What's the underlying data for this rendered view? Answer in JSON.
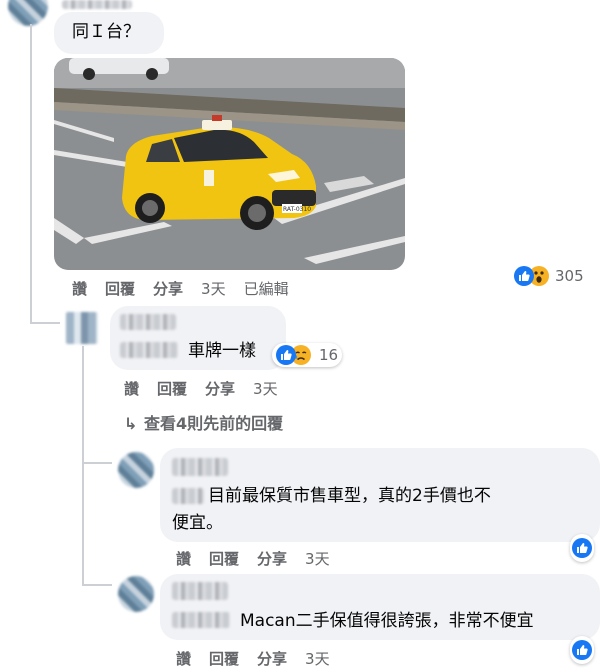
{
  "comment1": {
    "text": "同Ｉ台？",
    "actions": {
      "like": "讚",
      "reply": "回覆",
      "share": "分享",
      "time": "3天",
      "edited": "已編輯"
    },
    "reactions": {
      "count": "305",
      "icons": [
        "like-icon",
        "wow-icon"
      ]
    }
  },
  "comment2": {
    "text": "車牌一樣",
    "actions": {
      "like": "讚",
      "reply": "回覆",
      "share": "分享",
      "time": "3天"
    },
    "reactions": {
      "count": "16",
      "icons": [
        "like-icon",
        "sad-icon"
      ]
    }
  },
  "view_previous": {
    "label": "查看4則先前的回覆"
  },
  "comment3": {
    "text_line1": "目前最保質市售車型，真的2手價也不",
    "text_line2": "便宜。",
    "actions": {
      "like": "讚",
      "reply": "回覆",
      "share": "分享",
      "time": "3天"
    },
    "reactions": {
      "icons": [
        "like-icon"
      ]
    }
  },
  "comment4": {
    "text": "Macan二手保值得很誇張，非常不便宜",
    "actions": {
      "like": "讚",
      "reply": "回覆",
      "share": "分享",
      "time": "3天"
    },
    "reactions": {
      "icons": [
        "like-icon"
      ]
    }
  },
  "photo": {
    "plate_text": "RAT-0310"
  },
  "colors": {
    "like_blue": "#1877f2",
    "bubble": "#f0f2f5",
    "muted_text": "#65676b",
    "taxi_yellow": "#f2c412"
  }
}
